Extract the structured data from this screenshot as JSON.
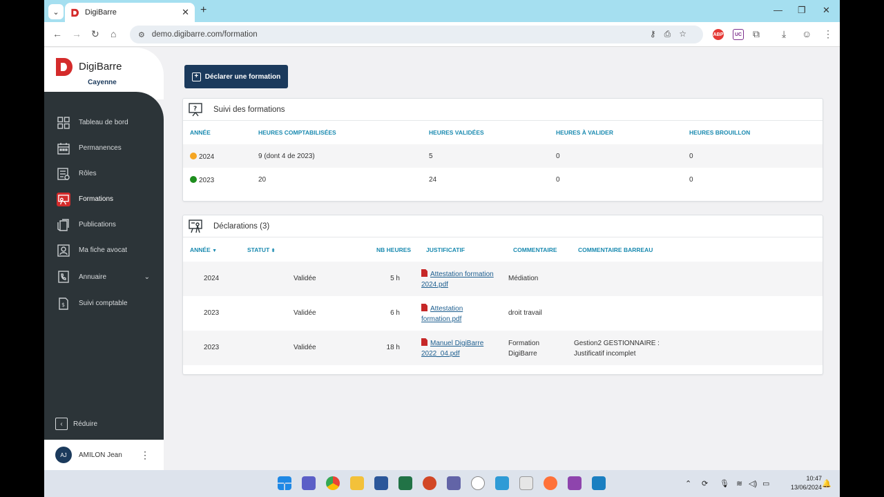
{
  "browser": {
    "tab_title": "DigiBarre",
    "url": "demo.digibarre.com/formation",
    "ext_abp": "ABP",
    "ext_uc": "UC"
  },
  "sidebar": {
    "brand": "DigiBarre",
    "city": "Cayenne",
    "items": [
      {
        "label": "Tableau de bord",
        "icon": "dashboard-icon"
      },
      {
        "label": "Permanences",
        "icon": "calendar-icon"
      },
      {
        "label": "Rôles",
        "icon": "roles-icon"
      },
      {
        "label": "Formations",
        "icon": "formations-icon"
      },
      {
        "label": "Publications",
        "icon": "publications-icon"
      },
      {
        "label": "Ma fiche avocat",
        "icon": "profile-card-icon"
      },
      {
        "label": "Annuaire",
        "icon": "phonebook-icon"
      },
      {
        "label": "Suivi comptable",
        "icon": "accounting-icon"
      }
    ],
    "reduce_label": "Réduire",
    "user": {
      "initials": "AJ",
      "name": "AMILON Jean"
    }
  },
  "main": {
    "declare_button": "Déclarer une formation",
    "suivi": {
      "title": "Suivi des formations",
      "headers": [
        "ANNÉE",
        "HEURES COMPTABILISÉES",
        "HEURES VALIDÉES",
        "HEURES À VALIDER",
        "HEURES BROUILLON"
      ],
      "rows": [
        {
          "year": "2024",
          "dot_color": "#f5a623",
          "comptabilisees": "9 (dont 4 de 2023)",
          "validees": "5",
          "a_valider": "0",
          "brouillon": "0"
        },
        {
          "year": "2023",
          "dot_color": "#1e8e1e",
          "comptabilisees": "20",
          "validees": "24",
          "a_valider": "0",
          "brouillon": "0"
        }
      ]
    },
    "declarations": {
      "title": "Déclarations (3)",
      "headers": [
        "ANNÉE",
        "STATUT",
        "NB HEURES",
        "JUSTIFICATIF",
        "COMMENTAIRE",
        "COMMENTAIRE BARREAU"
      ],
      "rows": [
        {
          "year": "2024",
          "status": "Validée",
          "hours": "5 h",
          "file_l1": "Attestation formation",
          "file_l2": "2024.pdf",
          "comment_l1": "Médiation",
          "comment_l2": "",
          "barreau_l1": "",
          "barreau_l2": ""
        },
        {
          "year": "2023",
          "status": "Validée",
          "hours": "6 h",
          "file_l1": "Attestation",
          "file_l2": "formation.pdf",
          "comment_l1": "droit travail",
          "comment_l2": "",
          "barreau_l1": "",
          "barreau_l2": ""
        },
        {
          "year": "2023",
          "status": "Validée",
          "hours": "18 h",
          "file_l1": "Manuel DigiBarre",
          "file_l2": "2022_04.pdf",
          "comment_l1": "Formation",
          "comment_l2": "DigiBarre",
          "barreau_l1": "Gestion2 GESTIONNAIRE :",
          "barreau_l2": "Justificatif incomplet"
        }
      ]
    }
  },
  "taskbar": {
    "time": "10:47",
    "date": "13/06/2024"
  }
}
